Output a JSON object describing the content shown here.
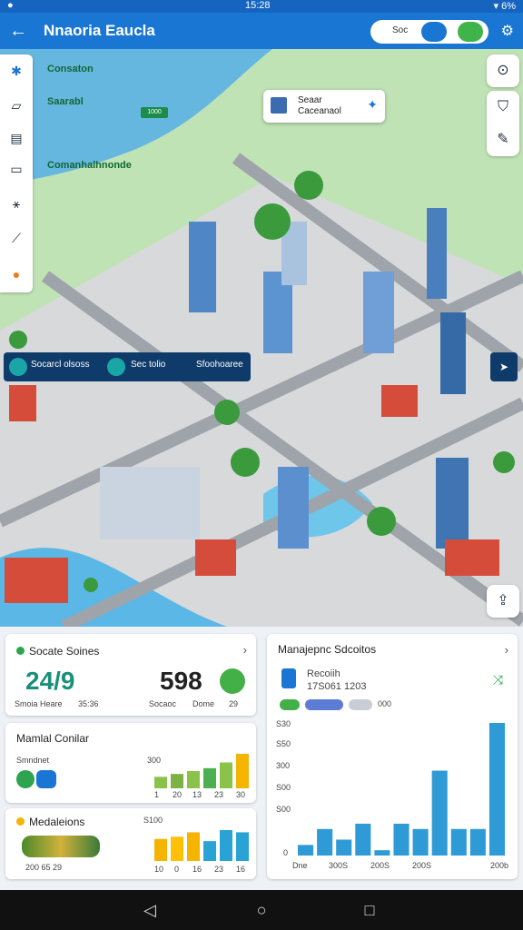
{
  "status": {
    "left": "●",
    "time": "15:28",
    "right": "▾ 6%"
  },
  "appbar": {
    "title": "Nnaoria Eaucla",
    "search_text": "Soc"
  },
  "map": {
    "labels": [
      "Consaton",
      "Saarabl",
      "Comanhalhnonde"
    ],
    "chip_text": "1000",
    "popcard": {
      "line1": "Seaar",
      "line2": "Caceanaol"
    }
  },
  "infobar": {
    "item1": "Socarcl olsoss",
    "item2": "Sec tolio",
    "item3": "Sfoohoaree"
  },
  "cards": {
    "system": {
      "title": "Socate Soines",
      "value1": "24/9",
      "value2": "598",
      "label1": "Smoia Heare",
      "label2": "35:36",
      "label3": "Socaoc",
      "label4": "Dome",
      "label5": "29"
    },
    "manual": {
      "title": "Mamlal Conilar",
      "label": "Smndnet",
      "top": "300",
      "ticks": [
        "1",
        "20",
        "13",
        "23",
        "30"
      ],
      "values": [
        4,
        5,
        6,
        7,
        9,
        12
      ]
    },
    "media": {
      "title": "Medaleions",
      "top": "S100",
      "ticks": [
        "10",
        "0",
        "16",
        "23",
        "16"
      ],
      "footer": "200 65 29",
      "values": [
        10,
        11,
        13,
        9,
        14,
        13
      ]
    },
    "management": {
      "title": "Manajepnc Sdcoitos",
      "sub1": "Recoiih",
      "sub2": "17S061 1203",
      "pill": "000",
      "y_ticks": [
        "S30",
        "S50",
        "300",
        "S00",
        "S00",
        "0"
      ],
      "x_ticks": [
        "Dne",
        "300S",
        "200S",
        "200S",
        "200b"
      ],
      "values": [
        2,
        5,
        3,
        6,
        1,
        6,
        5,
        16,
        5,
        5,
        25
      ]
    }
  },
  "nav": {
    "back": "◁",
    "home": "○",
    "recents": "□"
  }
}
